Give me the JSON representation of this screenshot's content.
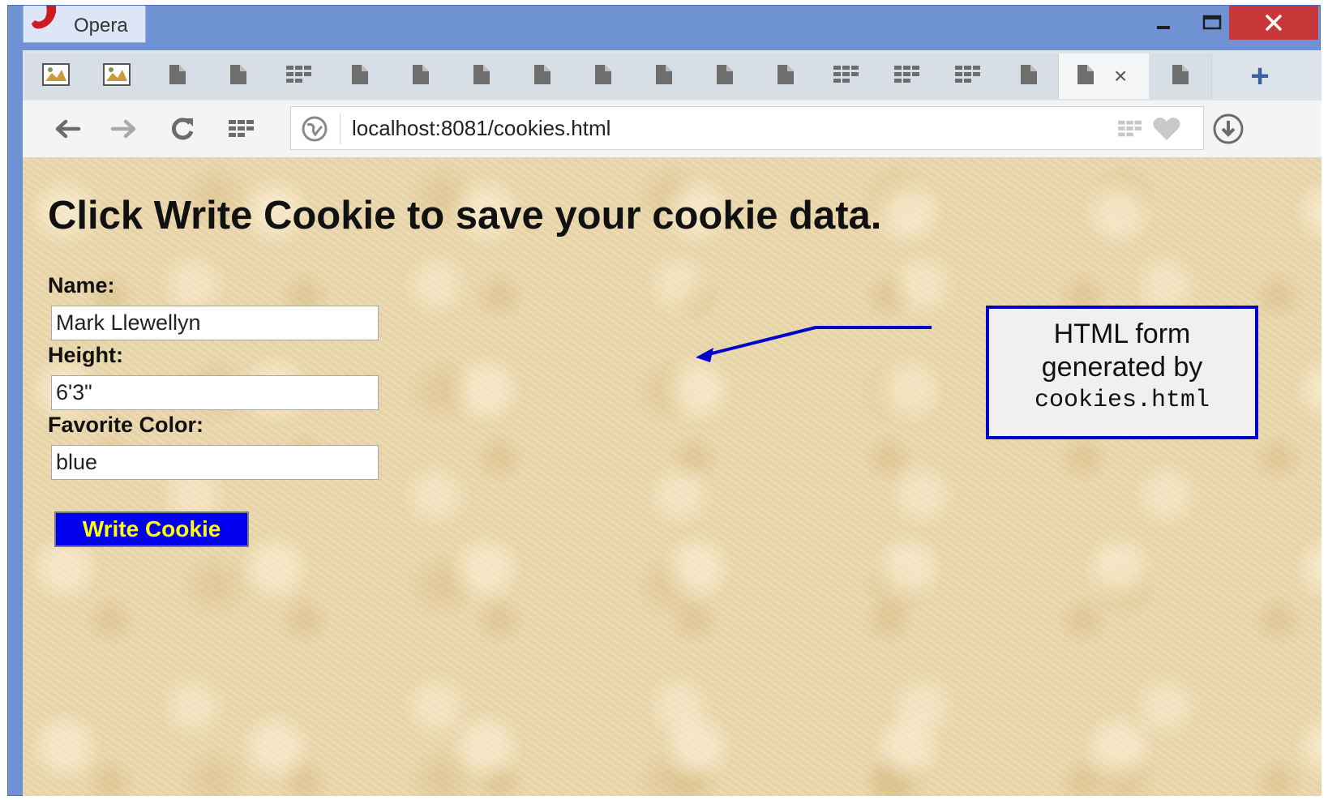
{
  "window": {
    "app_name": "Opera",
    "controls": {
      "minimize": "–",
      "maximize": "☐",
      "close": "✕"
    },
    "colors": {
      "frame": "#6f93d2",
      "close_button": "#c8373a"
    }
  },
  "tabs": {
    "items": [
      {
        "icon": "thumbnail-icon"
      },
      {
        "icon": "thumbnail-icon"
      },
      {
        "icon": "page-icon"
      },
      {
        "icon": "page-icon"
      },
      {
        "icon": "grid-icon"
      },
      {
        "icon": "page-icon"
      },
      {
        "icon": "page-icon"
      },
      {
        "icon": "page-icon"
      },
      {
        "icon": "page-icon"
      },
      {
        "icon": "page-icon"
      },
      {
        "icon": "page-icon"
      },
      {
        "icon": "page-icon"
      },
      {
        "icon": "page-icon"
      },
      {
        "icon": "grid-icon"
      },
      {
        "icon": "grid-icon"
      },
      {
        "icon": "grid-icon"
      },
      {
        "icon": "page-icon"
      },
      {
        "icon": "page-icon",
        "active": true
      },
      {
        "icon": "page-icon"
      }
    ],
    "close_label": "×",
    "add_label": "+"
  },
  "navigation": {
    "back_icon": "back-arrow-icon",
    "forward_icon": "forward-arrow-icon",
    "reload_icon": "reload-icon",
    "speed_dial_icon": "grid-icon",
    "url": "localhost:8081/cookies.html"
  },
  "page": {
    "heading": "Click Write Cookie to save your cookie data.",
    "fields": {
      "name": {
        "label": "Name:",
        "value": "Mark Llewellyn"
      },
      "height": {
        "label": "Height:",
        "value": "6'3\""
      },
      "color": {
        "label": "Favorite Color:",
        "value": "blue"
      }
    },
    "submit_label": "Write Cookie",
    "colors": {
      "button_bg": "#0000ee",
      "button_text": "#ffff00",
      "background": "#ead7ad"
    }
  },
  "annotation": {
    "line1": "HTML form",
    "line2": "generated by",
    "code": "cookies.html",
    "color": "#0000cc"
  }
}
